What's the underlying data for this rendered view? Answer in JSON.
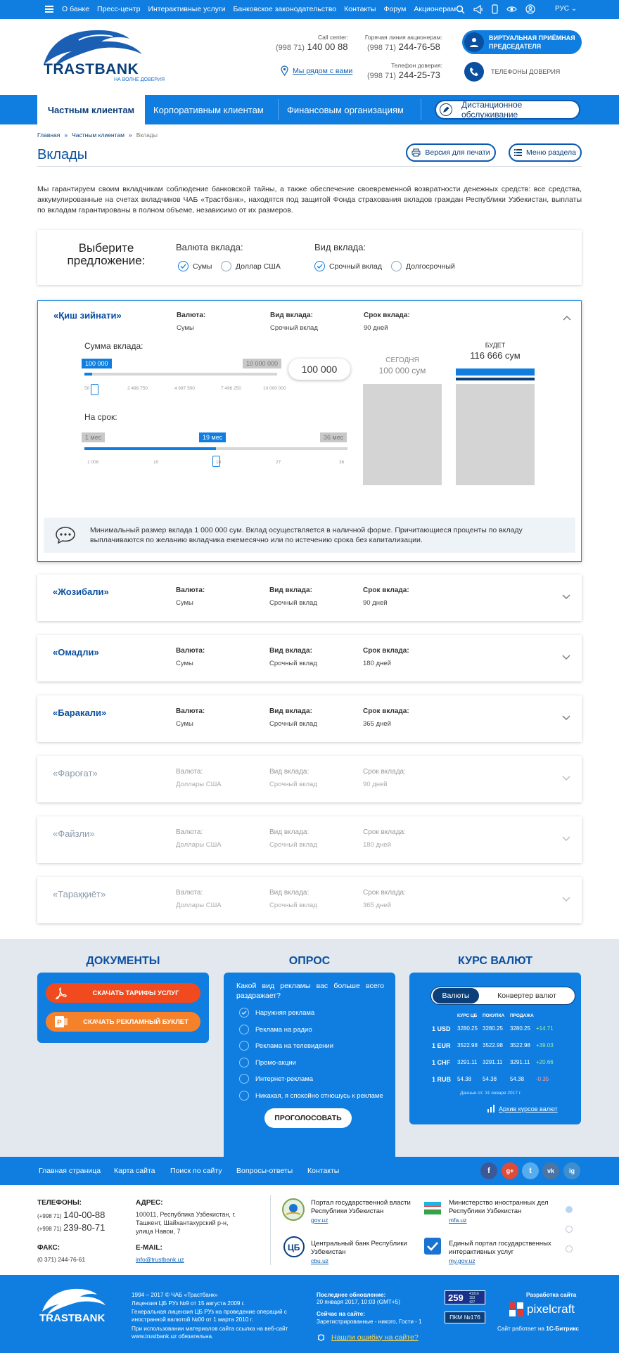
{
  "topbar": {
    "nav": [
      "О банке",
      "Пресс-центр",
      "Интерактивные услуги",
      "Банковское законодательство",
      "Контакты",
      "Форум",
      "Акционерам"
    ],
    "lang": "РУС"
  },
  "logo": {
    "name": "TRASTBANK",
    "tagline": "НА ВОЛНЕ ДОВЕРИЯ"
  },
  "contacts": {
    "call_label": "Call center:",
    "call_code": "(998 71)",
    "call_num": "140 00 88",
    "hot_label": "Горячая линия акционерам:",
    "hot_code": "(998 71)",
    "hot_num": "244-76-58",
    "trust_label": "Телефон доверия:",
    "trust_code": "(998 71)",
    "trust_num": "244-25-73",
    "nearby": "Мы рядом с вами"
  },
  "header_buttons": {
    "virtual_l1": "ВИРТУАЛЬНАЯ ПРИЁМНАЯ",
    "virtual_l2": "ПРЕДСЕДАТЕЛЯ",
    "trust": "ТЕЛЕФОНЫ ДОВЕРИЯ"
  },
  "mainnav": {
    "tabs": [
      "Частным клиентам",
      "Корпоративным клиентам",
      "Финансовым организациям"
    ],
    "remote": "Дистанционное обслуживание"
  },
  "breadcrumbs": [
    "Главная",
    "Частным клиентам",
    "Вклады"
  ],
  "page": {
    "title": "Вклады",
    "print": "Версия для печати",
    "menu": "Меню раздела",
    "intro": "Мы гарантируем своим вкладчикам соблюдение банковской тайны, а также обеспечение своевременной возвратности денежных средств: все средства, аккумулированные на счетах вкладчиков ЧАБ «Трастбанк», находятся под защитой Фонда страхования вкладов граждан Республики Узбекистан, выплаты по вкладам гарантированы в полном объеме, независимо от их размеров."
  },
  "chooser": {
    "title_l1": "Выберите",
    "title_l2": "предложение:",
    "currency_label": "Валюта вклада:",
    "currency_opts": [
      "Сумы",
      "Доллар США"
    ],
    "type_label": "Вид вклада:",
    "type_opts": [
      "Срочный вклад",
      "Долгосрочный"
    ]
  },
  "labels": {
    "currency": "Валюта:",
    "type": "Вид вклада:",
    "term": "Срок вклада:"
  },
  "calc": {
    "sum_label": "Сумма вклада:",
    "sum_min": "100 000",
    "sum_max": "10 000 000",
    "sum_ticks": [
      "50",
      "2 498 750",
      "4 997 500",
      "7 496 250",
      "10 000 000"
    ],
    "term_label": "На срок:",
    "term_min": "1 мес",
    "term_max": "36 мес",
    "term_value": "19 мес",
    "term_ticks": [
      "1 008",
      "10",
      "18",
      "27",
      "36"
    ],
    "amount": "100 000",
    "today_label": "СЕГОДНЯ",
    "today_value": "100 000 сум",
    "future_label": "БУДЕТ",
    "future_value": "116 666 сум",
    "term_fraction": 0.5,
    "sum_fraction": 0.04,
    "note": "Минимальный размер вклада 1 000 000 сум. Вклад осуществляется в наличной форме. Причитающиеся проценты по вкладу выплачиваются по желанию вкладчика ежемесячно или по истечению срока без капитализации."
  },
  "deposits": [
    {
      "name": "«Қиш зийнати»",
      "currency": "Сумы",
      "type": "Срочный вклад",
      "term": "90 дней"
    },
    {
      "name": "«Жозибали»",
      "currency": "Сумы",
      "type": "Срочный вклад",
      "term": "90 дней"
    },
    {
      "name": "«Омадли»",
      "currency": "Сумы",
      "type": "Срочный вклад",
      "term": "180 дней"
    },
    {
      "name": "«Баракали»",
      "currency": "Сумы",
      "type": "Срочный вклад",
      "term": "365 дней"
    },
    {
      "name": "«Фароғат»",
      "currency": "Доллары США",
      "type": "Срочный вклад",
      "term": "90 дней"
    },
    {
      "name": "«Файзли»",
      "currency": "Доллары США",
      "type": "Срочный вклад",
      "term": "180 дней"
    },
    {
      "name": "«Тараққиёт»",
      "currency": "Доллары США",
      "type": "Срочный вклад",
      "term": "365 дней"
    }
  ],
  "docs": {
    "title": "ДОКУМЕНТЫ",
    "btn1": "СКАЧАТЬ ТАРИФЫ УСЛУГ",
    "btn2": "СКАЧАТЬ РЕКЛАМНЫЙ БУКЛЕТ",
    "btn1_color": "#f04a1e",
    "btn2_color": "#f5822a"
  },
  "poll": {
    "title": "ОПРОС",
    "question": "Какой вид рекламы вас больше всего раздражает?",
    "options": [
      "Наружняя реклама",
      "Реклама на радио",
      "Реклама на телевидении",
      "Промо-акции",
      "Интернет-реклама",
      "Никакая, я спокойно отношусь к рекламе"
    ],
    "vote": "ПРОГОЛОСОВАТЬ"
  },
  "rates": {
    "title": "КУРС ВАЛЮТ",
    "tab_a": "Валюты",
    "tab_b": "Конвертер валют",
    "headers": [
      "КУРС ЦБ",
      "ПОКУПКА",
      "ПРОДАЖА"
    ],
    "rows": [
      [
        "1 USD",
        "3280.25",
        "3280.25",
        "3280.25",
        "+14.71"
      ],
      [
        "1 EUR",
        "3522.98",
        "3522.98",
        "3522.98",
        "+39.03"
      ],
      [
        "1 CHF",
        "3291.11",
        "3291.11",
        "3291.11",
        "+20.66"
      ],
      [
        "1 RUB",
        "54.38",
        "54.38",
        "54.38",
        "-0.35"
      ]
    ],
    "date": "Данные от: 31 января 2017 г.",
    "archive": "Архив курсов валют"
  },
  "footer_nav": [
    "Главная страница",
    "Карта сайта",
    "Поиск по сайту",
    "Вопросы-ответы",
    "Контакты"
  ],
  "social": [
    "f",
    "g+",
    "t",
    "vk",
    "ig"
  ],
  "footer_info": {
    "phones_h": "ТЕЛЕФОНЫ:",
    "p1_code": "(+998 71)",
    "p1": "140-00-88",
    "p2_code": "(+998 71)",
    "p2": "239-80-71",
    "fax_h": "ФАКС:",
    "fax": "(0 371) 244-76-61",
    "addr_h": "АДРЕС:",
    "addr": "100011, Республика Узбекистан, г. Ташкент, Шайхантахурский р-н, улица Навои, 7",
    "email_h": "E-MAIL:",
    "email": "info@trustbank.uz"
  },
  "partners": [
    {
      "name": "Портал государственной власти Республики Узбекистан",
      "url": "gov.uz"
    },
    {
      "name": "Министерство иностранных дел Республики Узбекистан",
      "url": "mfa.uz"
    },
    {
      "name": "Центральный банк Республики Узбекистан",
      "url": "cbu.uz"
    },
    {
      "name": "Единый портал государственных интерактивных услуг",
      "url": "my.gov.uz"
    }
  ],
  "bottom": {
    "copy": "1994 – 2017 © ЧАБ «Трастбанк»",
    "lic1": "Лицензия ЦБ РУз №9 от 15 августа 2009 г.",
    "lic2": "Генеральная лицензия ЦБ РУз на проведение операций с иностранной валютой №00 от 1 марта 2010 г.",
    "note": "При использовании материалов сайта ссылка на веб-сайт www.trustbank.uz обязательна.",
    "upd_h": "Последнее обновление:",
    "upd": "20 января 2017, 10:03 (GMT+5)",
    "now_h": "Сейчас на сайте:",
    "now": "Зарегистрированные - никого, Гости - 1",
    "err": "Нашли ошибку на сайте?",
    "counter": "259",
    "counter_small": [
      "41016",
      "153",
      "427"
    ],
    "pkm": "ПКМ №176",
    "dev_h": "Разработка сайта",
    "dev": "pixelcraft",
    "bitrix_pre": "Сайт работает на",
    "bitrix": "1С-Битрикс"
  }
}
